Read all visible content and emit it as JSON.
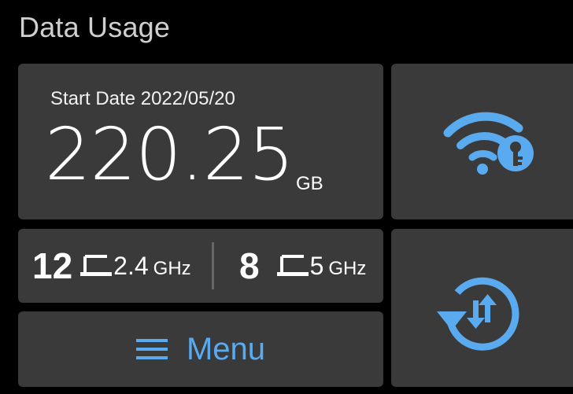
{
  "header": {
    "title": "Data Usage"
  },
  "usage": {
    "start_label": "Start Date 2022/05/20",
    "value": "220.25",
    "unit": "GB"
  },
  "devices": {
    "band_24": {
      "count": "12",
      "band": "2.4",
      "unit": "GHz",
      "icon": "laptop-icon"
    },
    "band_5": {
      "count": "8",
      "band": "5",
      "unit": "GHz",
      "icon": "laptop-icon"
    }
  },
  "menu": {
    "label": "Menu",
    "icon": "hamburger-menu-icon"
  },
  "wifi_key": {
    "icon": "wifi-key-icon"
  },
  "reset": {
    "icon": "data-reset-icon"
  },
  "colors": {
    "accent": "#5aaaf0",
    "card": "#3a3a3a",
    "background": "#000000"
  }
}
